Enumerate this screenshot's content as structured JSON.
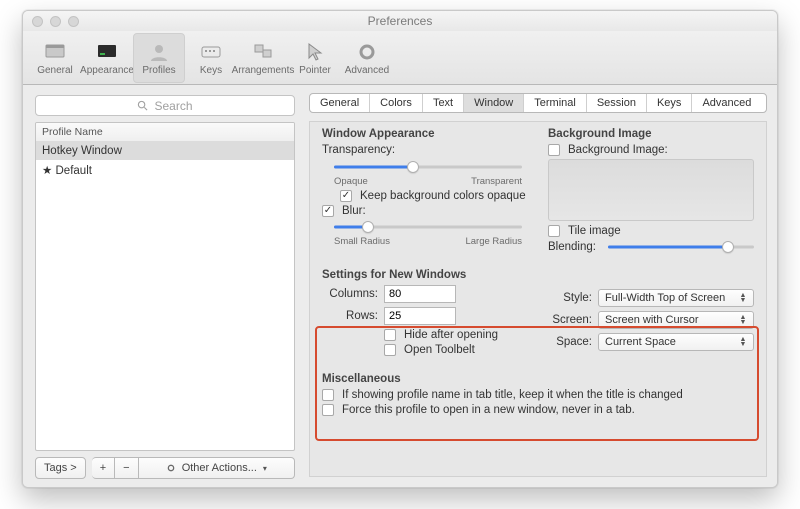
{
  "window": {
    "title": "Preferences"
  },
  "toolbar": {
    "items": [
      {
        "label": "General"
      },
      {
        "label": "Appearance"
      },
      {
        "label": "Profiles"
      },
      {
        "label": "Keys"
      },
      {
        "label": "Arrangements"
      },
      {
        "label": "Pointer"
      },
      {
        "label": "Advanced"
      }
    ]
  },
  "search": {
    "placeholder": "Search"
  },
  "profiles": {
    "header": "Profile Name",
    "rows": [
      {
        "label": "Hotkey Window",
        "selected": true
      },
      {
        "label": "★ Default",
        "selected": false
      }
    ]
  },
  "sidebar_bottom": {
    "tags": "Tags >",
    "plus": "+",
    "minus": "−",
    "other_actions": "Other Actions..."
  },
  "tabs": [
    "General",
    "Colors",
    "Text",
    "Window",
    "Terminal",
    "Session",
    "Keys",
    "Advanced"
  ],
  "active_tab": "Window",
  "window_appearance": {
    "title": "Window Appearance",
    "transparency_label": "Transparency:",
    "opaque": "Opaque",
    "transparent": "Transparent",
    "keep_bg_opaque": "Keep background colors opaque",
    "blur": "Blur:",
    "small_radius": "Small Radius",
    "large_radius": "Large Radius"
  },
  "background_image": {
    "title": "Background Image",
    "checkbox": "Background Image:",
    "tile": "Tile image",
    "blending": "Blending:"
  },
  "new_windows": {
    "title": "Settings for New Windows",
    "columns_label": "Columns:",
    "columns_value": "80",
    "rows_label": "Rows:",
    "rows_value": "25",
    "hide_after": "Hide after opening",
    "open_toolbelt": "Open Toolbelt",
    "style_label": "Style:",
    "style_value": "Full-Width Top of Screen",
    "screen_label": "Screen:",
    "screen_value": "Screen with Cursor",
    "space_label": "Space:",
    "space_value": "Current Space"
  },
  "misc": {
    "title": "Miscellaneous",
    "opt1": "If showing profile name in tab title, keep it when the title is changed",
    "opt2": "Force this profile to open in a new window, never in a tab."
  }
}
